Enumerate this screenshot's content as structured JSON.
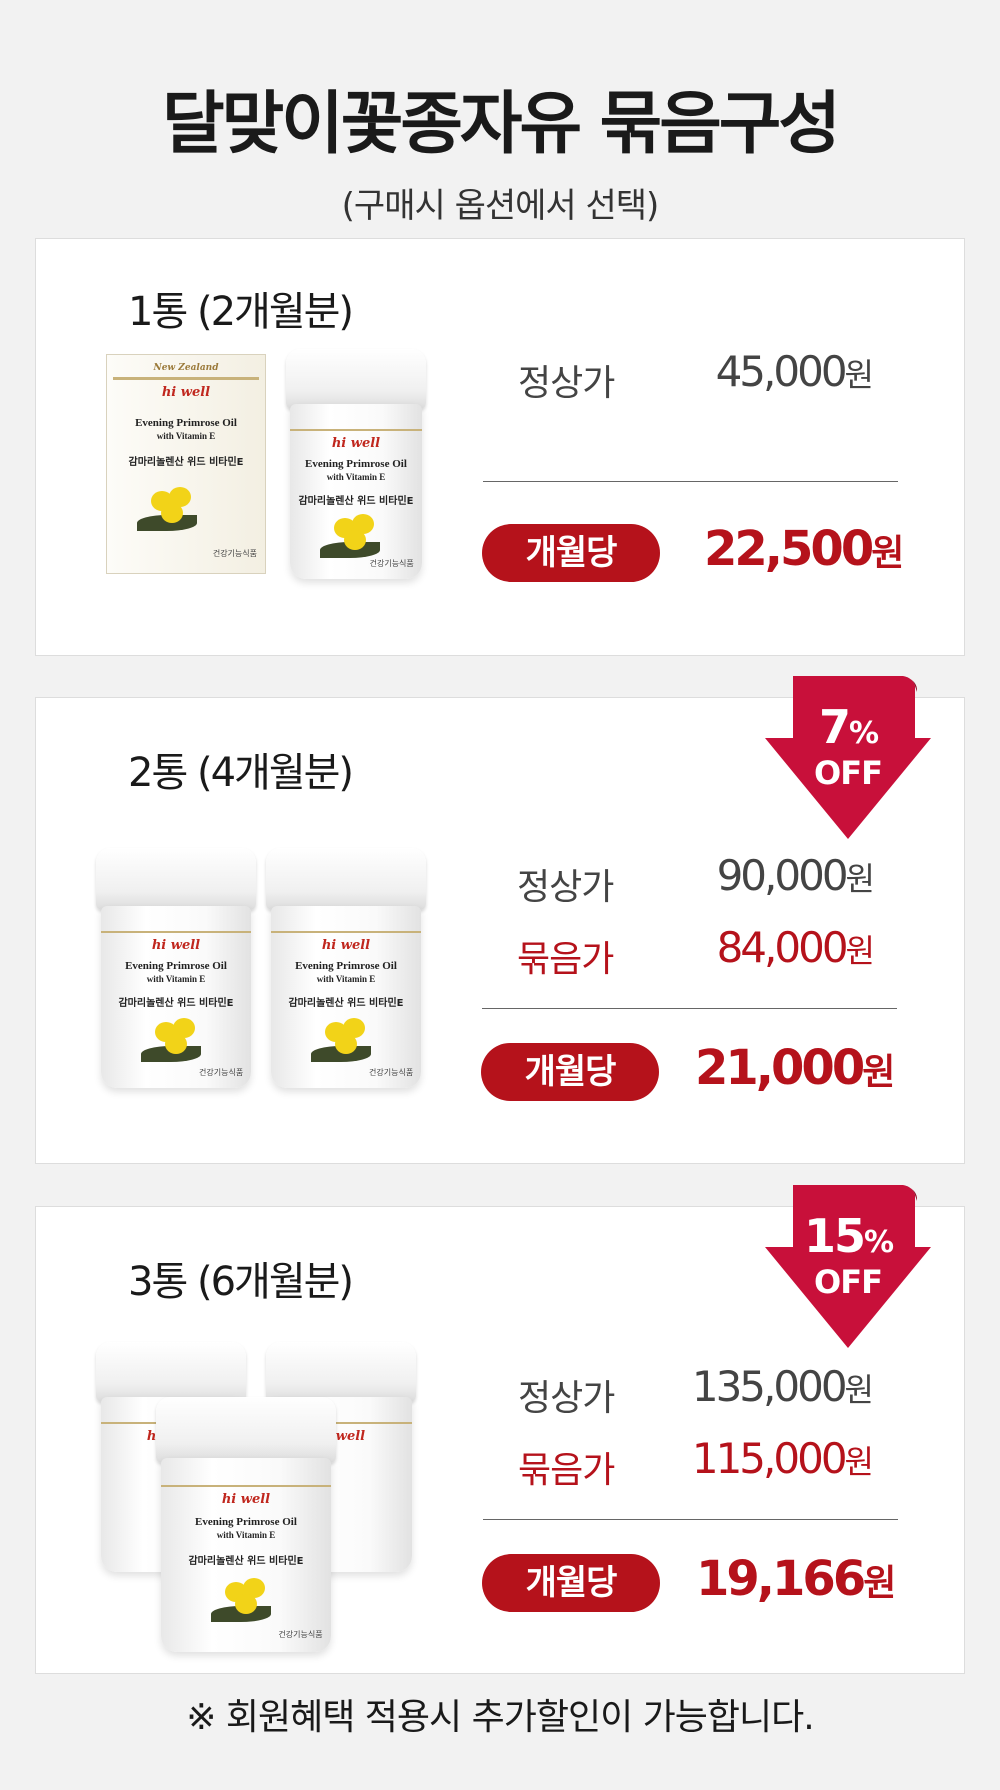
{
  "header": {
    "title": "달맞이꽃종자유 묶음구성",
    "subtitle": "(구매시 옵션에서 선택)"
  },
  "packages": [
    {
      "title": "1통 (2개월분)",
      "regular_label": "정상가",
      "regular_price": "45,000",
      "monthly_label": "개월당",
      "monthly_price": "22,500"
    },
    {
      "title": "2통 (4개월분)",
      "discount_percent": "7",
      "discount_suffix": "OFF",
      "regular_label": "정상가",
      "regular_price": "90,000",
      "bundle_label": "묶음가",
      "bundle_price": "84,000",
      "monthly_label": "개월당",
      "monthly_price": "21,000"
    },
    {
      "title": "3통 (6개월분)",
      "discount_percent": "15",
      "discount_suffix": "OFF",
      "regular_label": "정상가",
      "regular_price": "135,000",
      "bundle_label": "묶음가",
      "bundle_price": "115,000",
      "monthly_label": "개월당",
      "monthly_price": "19,166"
    }
  ],
  "currency_unit": "원",
  "percent_sign": "%",
  "product": {
    "brand": "hi well",
    "origin": "New Zealand",
    "name_en": "Evening Primrose Oil",
    "sub_en": "with Vitamin E",
    "name_ko": "감마리놀렌산 위드 비타민E",
    "category": "건강기능식품"
  },
  "footnote": "※ 회원혜택 적용시 추가할인이 가능합니다.",
  "colors": {
    "accent_red": "#b5121b",
    "badge_red": "#c8103a",
    "background": "#f2f2f2",
    "card": "#ffffff"
  }
}
